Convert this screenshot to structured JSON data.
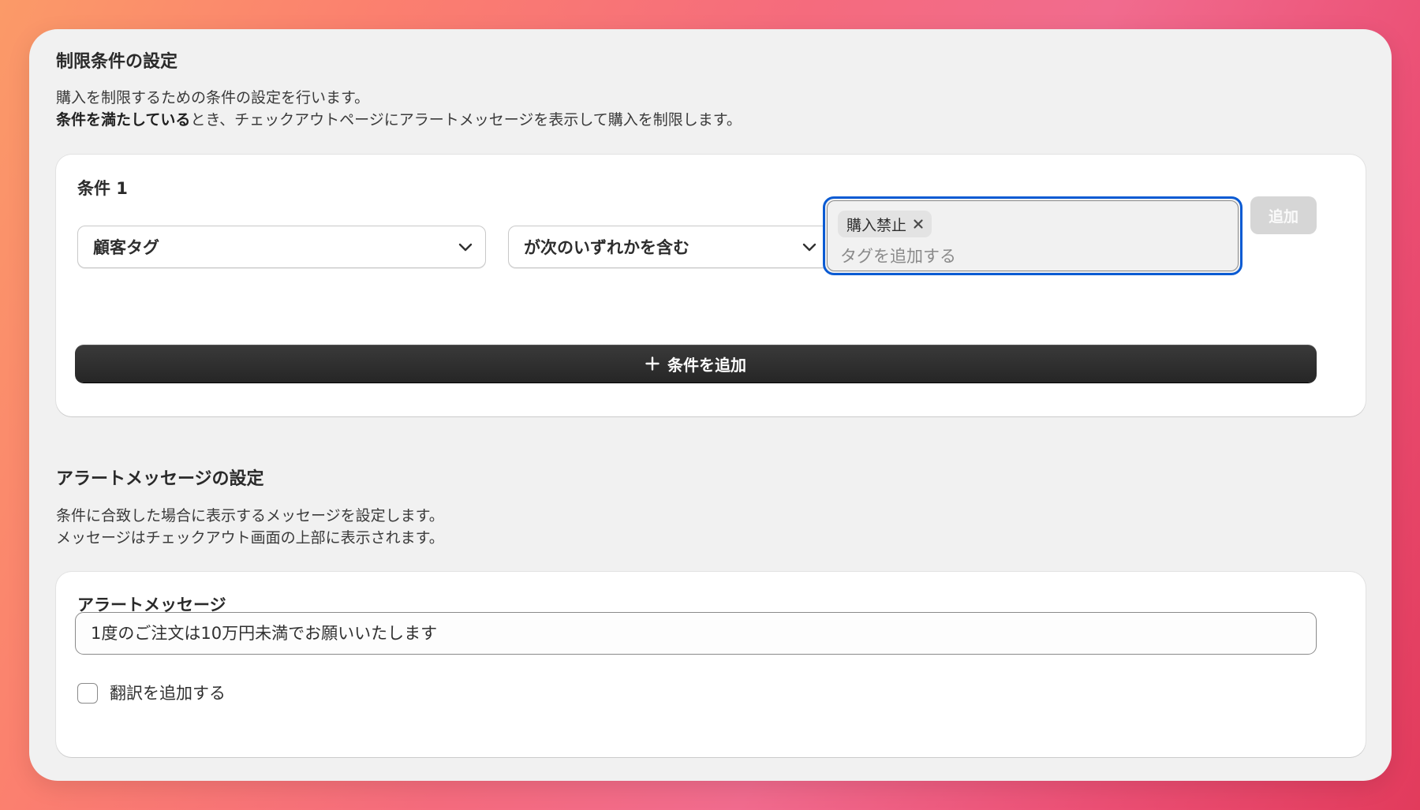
{
  "restrictions": {
    "title": "制限条件の設定",
    "desc_line1": "購入を制限するための条件の設定を行います。",
    "desc_line2_bold": "条件を満たしている",
    "desc_line2_rest": "とき、チェックアウトページにアラートメッセージを表示して購入を制限します。",
    "condition": {
      "title": "条件 1",
      "field_select": "顧客タグ",
      "operator_select": "が次のいずれかを含む",
      "tags": [
        "購入禁止"
      ],
      "tag_placeholder": "タグを追加する",
      "add_tag_label": "追加"
    },
    "add_condition_label": "条件を追加"
  },
  "alert": {
    "title": "アラートメッセージの設定",
    "desc_line1": "条件に合致した場合に表示するメッセージを設定します。",
    "desc_line2": "メッセージはチェックアウト画面の上部に表示されます。",
    "card_title": "アラートメッセージ",
    "message_value": "1度のご注文は10万円未満でお願いいたします",
    "translation_label": "翻訳を追加する",
    "translation_checked": false
  },
  "colors": {
    "focus_ring": "#0b5bd3",
    "primary_button": "#2f2f2f",
    "disabled_button": "#d6d6d6"
  },
  "icons": {
    "select_chevron": "chevron-down-icon",
    "tag_remove": "close-icon",
    "add_condition": "plus-icon"
  }
}
